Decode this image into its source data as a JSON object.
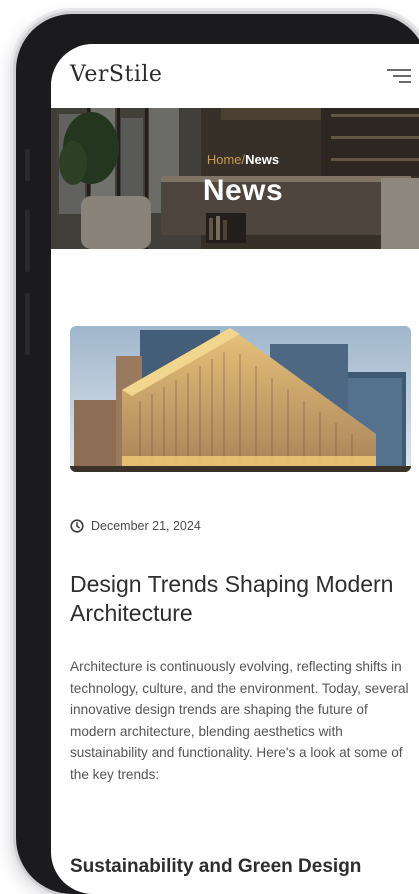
{
  "nav": {
    "logo": "VerStile",
    "menu_icon": "hamburger-menu-icon"
  },
  "hero": {
    "breadcrumb_home": "Home",
    "breadcrumb_separator": "/",
    "breadcrumb_current": "News",
    "title": "News"
  },
  "article": {
    "date_icon": "clock-icon",
    "date": "December 21, 2024",
    "title": "Design Trends Shaping Modern Architecture",
    "body": "Architecture is continuously evolving, reflecting shifts in technology, culture, and the environment. Today, several innovative design trends are shaping the future of modern architecture, blending aesthetics with sustainability and functionality. Here's a look at some of the key trends:",
    "section_heading": "Sustainability and Green Design"
  },
  "colors": {
    "accent": "#c99a5b",
    "text_dark": "#2e2e2e",
    "text_body": "#555555"
  }
}
